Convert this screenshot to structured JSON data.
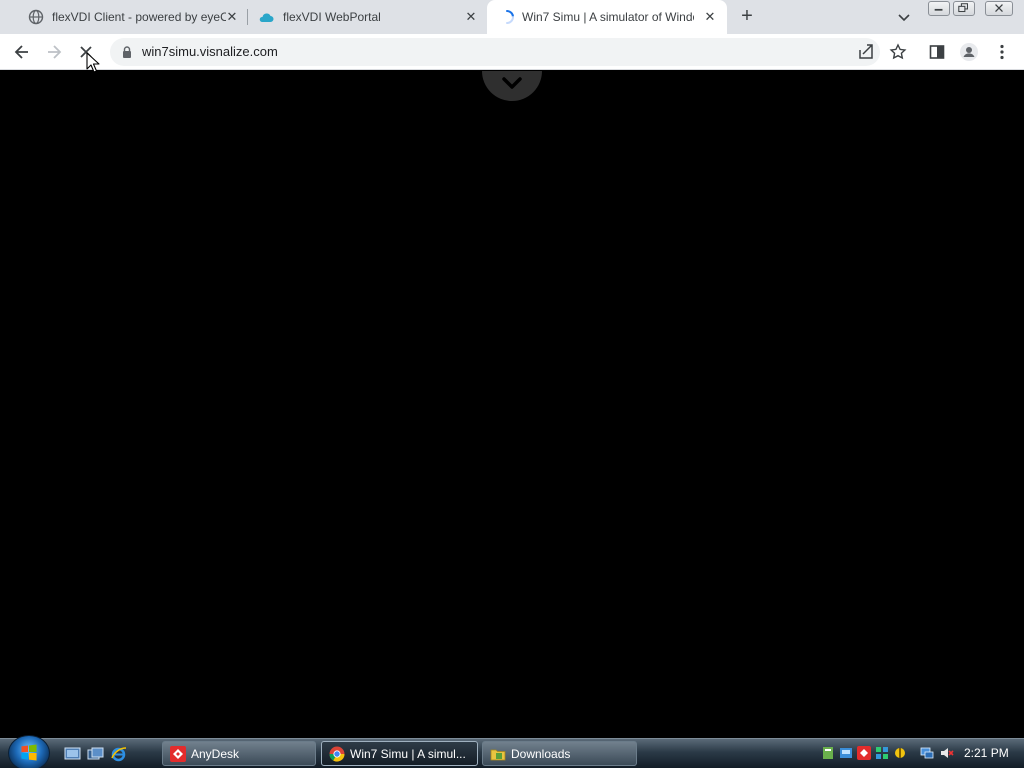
{
  "tabs": [
    {
      "title": "flexVDI Client - powered by eyeO",
      "icon": "globe-icon"
    },
    {
      "title": "flexVDI WebPortal",
      "icon": "cloud-icon"
    },
    {
      "title": "Win7 Simu | A simulator of Windo",
      "icon": "loading-spinner-icon",
      "active": true
    }
  ],
  "toolbar": {
    "url": "win7simu.visnalize.com",
    "back_icon": "arrow-left-icon",
    "forward_icon": "arrow-right-icon",
    "stop_icon": "close-icon"
  },
  "taskbar": {
    "buttons": [
      {
        "label": "AnyDesk",
        "icon": "anydesk-icon"
      },
      {
        "label": "Win7 Simu | A simul...",
        "icon": "chrome-icon",
        "active": true
      },
      {
        "label": "Downloads",
        "icon": "folder-icon"
      }
    ],
    "clock": "2:21 PM"
  },
  "colors": {
    "tabstrip_bg": "#dee1e6",
    "page_bg": "#000000",
    "omnibox_bg": "#f1f3f4"
  }
}
